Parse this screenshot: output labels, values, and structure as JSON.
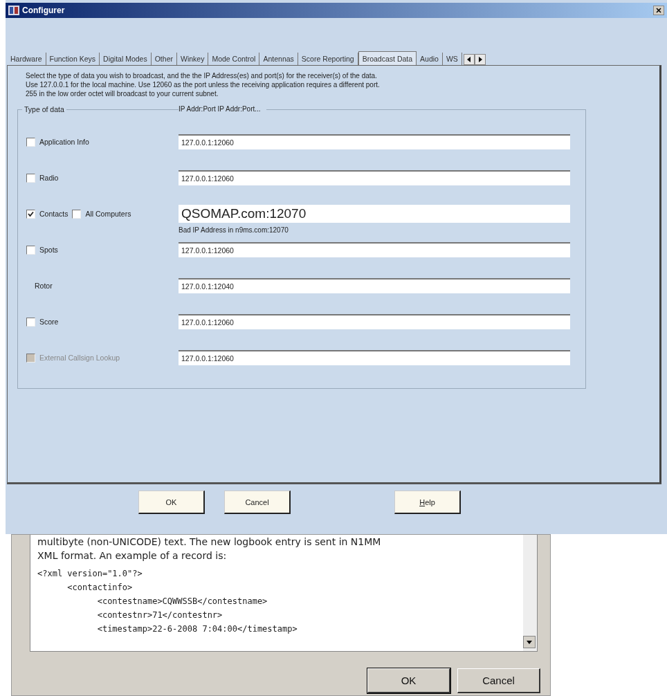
{
  "window": {
    "title": "Configurer"
  },
  "tabs": [
    {
      "label": "Hardware",
      "selected": false
    },
    {
      "label": "Function Keys",
      "selected": false
    },
    {
      "label": "Digital Modes",
      "selected": false
    },
    {
      "label": "Other",
      "selected": false
    },
    {
      "label": "Winkey",
      "selected": false
    },
    {
      "label": "Mode Control",
      "selected": false
    },
    {
      "label": "Antennas",
      "selected": false
    },
    {
      "label": "Score Reporting",
      "selected": false
    },
    {
      "label": "Broadcast Data",
      "selected": true
    },
    {
      "label": "Audio",
      "selected": false
    },
    {
      "label": "WS",
      "selected": false
    }
  ],
  "description": [
    "Select the type of data you wish to broadcast, and the the IP Address(es) and port(s) for the receiver(s) of the data.",
    "Use 127.0.0.1 for the local machine.  Use 12060 as the port unless the receiving application requires a different port.",
    "255 in the low order octet will broadcast to your current subnet."
  ],
  "group": {
    "title": "Type of data",
    "column_heading": "IP Addr:Port IP Addr:Port...",
    "rows": [
      {
        "kind": "checkbox",
        "label": "Application Info",
        "checked": false,
        "value": "127.0.0.1:12060"
      },
      {
        "kind": "checkbox",
        "label": "Radio",
        "checked": false,
        "value": "127.0.0.1:12060"
      },
      {
        "kind": "checkbox-extra",
        "label": "Contacts",
        "checked": true,
        "extra": {
          "label": "All Computers",
          "checked": false
        },
        "value": "QSOMAP.com:12070",
        "note": "Bad IP Address in n9ms.com:12070"
      },
      {
        "kind": "checkbox",
        "label": "Spots",
        "checked": false,
        "value": "127.0.0.1:12060"
      },
      {
        "kind": "plain",
        "label": "Rotor",
        "value": "127.0.0.1:12040"
      },
      {
        "kind": "checkbox",
        "label": "Score",
        "checked": false,
        "value": "127.0.0.1:12060"
      },
      {
        "kind": "checkbox-disabled",
        "label": "External Callsign Lookup",
        "checked": false,
        "value": "127.0.0.1:12060"
      }
    ]
  },
  "buttons": [
    {
      "label": "OK",
      "kind": "default"
    },
    {
      "label": "Cancel",
      "kind": "normal"
    },
    {
      "label": "Help",
      "kind": "help"
    }
  ],
  "back_dialog": {
    "text": [
      "multibyte (non-UNICODE) text. The new logbook entry is sent in N1MM",
      "XML format. An example of a record is:"
    ],
    "code": [
      "<?xml version=\"1.0\"?>",
      "      <contactinfo>",
      "            <contestname>CQWWSSB</contestname>",
      "            <contestnr>71</contestnr>",
      "            <timestamp>22-6-2008 7:04:00</timestamp>"
    ],
    "buttons": [
      {
        "label": "OK",
        "kind": "default"
      },
      {
        "label": "Cancel",
        "kind": "normal"
      }
    ]
  }
}
